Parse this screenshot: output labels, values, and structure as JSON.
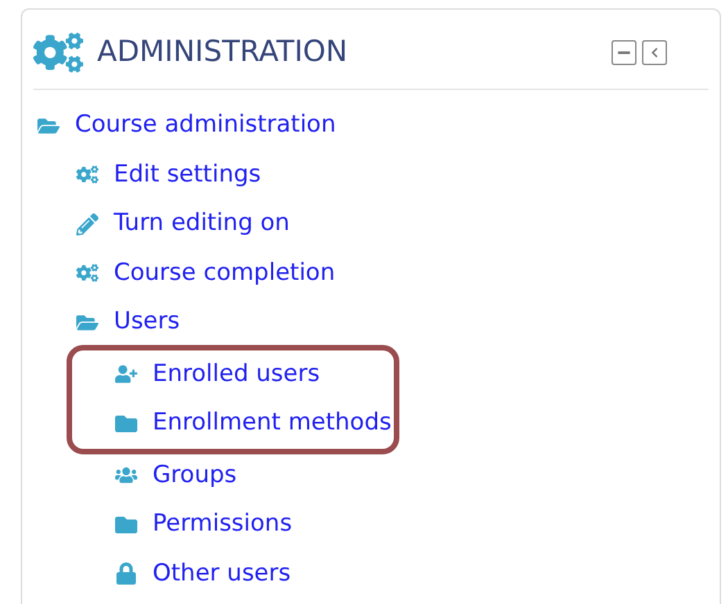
{
  "block": {
    "title": "ADMINISTRATION",
    "tree": [
      {
        "label": "Course administration",
        "kind": "folder-open",
        "highlighted": false,
        "children": [
          {
            "label": "Edit settings",
            "kind": "gears",
            "highlighted": false
          },
          {
            "label": "Turn editing on",
            "kind": "pencil",
            "highlighted": false
          },
          {
            "label": "Course completion",
            "kind": "gears",
            "highlighted": false
          },
          {
            "label": "Users",
            "kind": "folder-open",
            "highlighted": false,
            "children": [
              {
                "label": "Enrolled users",
                "kind": "user-plus",
                "highlighted": true
              },
              {
                "label": "Enrollment methods",
                "kind": "folder",
                "highlighted": true
              },
              {
                "label": "Groups",
                "kind": "users",
                "highlighted": false
              },
              {
                "label": "Permissions",
                "kind": "folder",
                "highlighted": false
              },
              {
                "label": "Other users",
                "kind": "lock",
                "highlighted": false
              }
            ]
          }
        ]
      }
    ]
  }
}
